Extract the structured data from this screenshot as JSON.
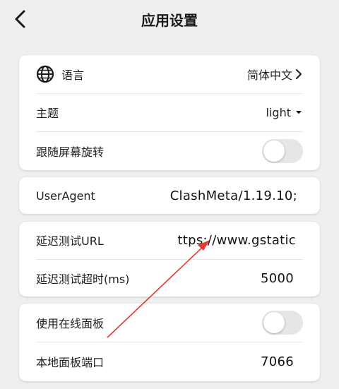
{
  "header": {
    "title": "应用设置",
    "back_icon": "back-arrow-icon"
  },
  "card1": {
    "language": {
      "icon": "globe-icon",
      "label": "语言",
      "value": "简体中文"
    },
    "theme": {
      "label": "主题",
      "value": "light"
    },
    "rotate": {
      "label": "跟随屏幕旋转",
      "enabled": false
    }
  },
  "card2": {
    "user_agent": {
      "label": "UserAgent",
      "value": "ClashMeta/1.19.10;"
    }
  },
  "card3": {
    "delay_url": {
      "label": "延迟测试URL",
      "value": "ttps://www.gstatic"
    },
    "delay_timeout": {
      "label": "延迟测试超时(ms)",
      "value": "5000"
    }
  },
  "card4": {
    "online_panel": {
      "label": "使用在线面板",
      "enabled": false
    },
    "local_port": {
      "label": "本地面板端口",
      "value": "7066"
    }
  },
  "annotation": {
    "color": "#e53935"
  }
}
